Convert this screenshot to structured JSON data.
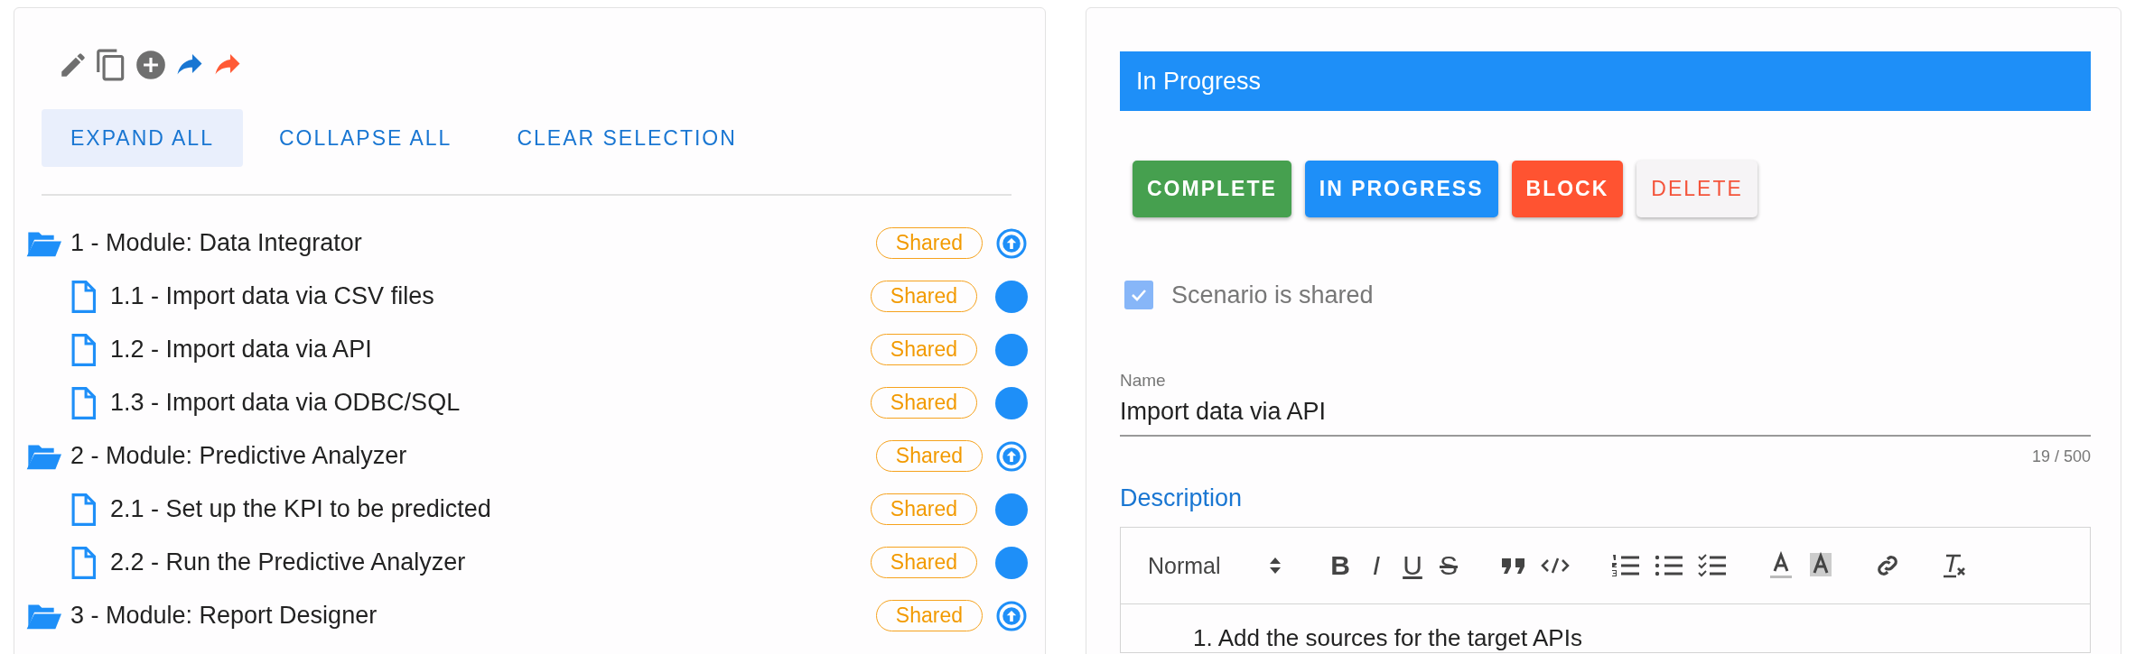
{
  "tree_actions": [
    {
      "label": "EXPAND ALL",
      "selected": true
    },
    {
      "label": "COLLAPSE ALL",
      "selected": false
    },
    {
      "label": "CLEAR SELECTION",
      "selected": false
    }
  ],
  "tree": [
    {
      "label": "1 - Module: Data Integrator",
      "badge": "Shared",
      "children": [
        {
          "label": "1.1 - Import data via CSV files",
          "badge": "Shared",
          "color": "#1e8ff8"
        },
        {
          "label": "1.2 - Import data via API",
          "badge": "Shared",
          "color": "#1e8ff8"
        },
        {
          "label": "1.3 - Import data via ODBC/SQL",
          "badge": "Shared",
          "color": "#1e8ff8"
        }
      ]
    },
    {
      "label": "2 - Module: Predictive Analyzer",
      "badge": "Shared",
      "children": [
        {
          "label": "2.1 - Set up the KPI to be predicted",
          "badge": "Shared",
          "color": "#1e8ff8"
        },
        {
          "label": "2.2 - Run the Predictive Analyzer",
          "badge": "Shared",
          "color": "#1e8ff8"
        }
      ]
    },
    {
      "label": "3 - Module: Report Designer",
      "badge": "Shared"
    }
  ],
  "detail": {
    "title": "In Progress",
    "status_buttons": [
      {
        "label": "COMPLETE",
        "kind": "complete"
      },
      {
        "label": "IN PROGRESS",
        "kind": "progress"
      },
      {
        "label": "BLOCK",
        "kind": "block"
      },
      {
        "label": "DELETE",
        "kind": "delete"
      }
    ],
    "shared": {
      "label": "Scenario is shared",
      "checked": true
    },
    "name": {
      "label": "Name",
      "value": "Import data via API",
      "counter": "19 / 500"
    },
    "description": {
      "label": "Description",
      "format": "Normal",
      "format_buttons": [
        "B",
        "I",
        "U",
        "S"
      ],
      "items": [
        {
          "number": "1.",
          "text": "Add the sources for the target APIs"
        }
      ]
    }
  }
}
